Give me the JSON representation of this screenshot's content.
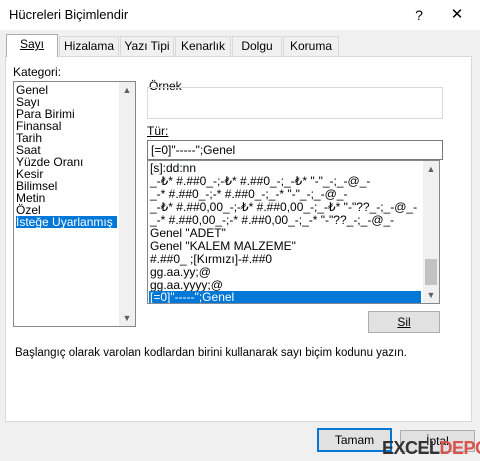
{
  "window": {
    "title": "Hücreleri Biçimlendir",
    "help_glyph": "?",
    "close_glyph": "✕"
  },
  "tabs": [
    {
      "label": "Sayı",
      "active": true
    },
    {
      "label": "Hizalama",
      "active": false
    },
    {
      "label": "Yazı Tipi",
      "active": false
    },
    {
      "label": "Kenarlık",
      "active": false
    },
    {
      "label": "Dolgu",
      "active": false
    },
    {
      "label": "Koruma",
      "active": false
    }
  ],
  "category": {
    "label": "Kategori:",
    "items": [
      "Genel",
      "Sayı",
      "Para Birimi",
      "Finansal",
      "Tarih",
      "Saat",
      "Yüzde Oranı",
      "Kesir",
      "Bilimsel",
      "Metin",
      "Özel",
      "İsteğe Uyarlanmış"
    ],
    "selected": "İsteğe Uyarlanmış"
  },
  "sample": {
    "label": "Örnek",
    "value": ""
  },
  "type": {
    "label": "Tür:",
    "value": "[=0]\"-----\";Genel",
    "items": [
      "[s]:dd:nn",
      "_-₺* #.##0_-;-₺* #.##0_-;_-₺* \"-\"_-;_-@_-",
      "_-* #.##0_-;-* #.##0_-;_-* \"-\"_-;_-@_-",
      "_-₺* #.##0,00_-;-₺* #.##0,00_-;_-₺* \"-\"??_-;_-@_-",
      "_-* #.##0,00_-;-* #.##0,00_-;_-* \"-\"??_-;_-@_-",
      "Genel \"ADET\"",
      "Genel \"KALEM MALZEME\"",
      "#.##0_ ;[Kırmızı]-#.##0",
      "gg.aa.yy;@",
      "gg.aa.yyyy;@",
      "[=0]\"-----\";Genel"
    ],
    "selected": "[=0]\"-----\";Genel"
  },
  "buttons": {
    "delete": "Sil",
    "ok": "Tamam",
    "cancel": "İptal"
  },
  "hint": "Başlangıç olarak varolan kodlardan birini kullanarak sayı biçim kodunu yazın.",
  "watermark": {
    "prefix": "EXCEL",
    "suffix": "DEPO"
  },
  "scroll": {
    "category_up": "▲",
    "category_down": "▼",
    "type_up": "▲",
    "type_down": "▼"
  }
}
